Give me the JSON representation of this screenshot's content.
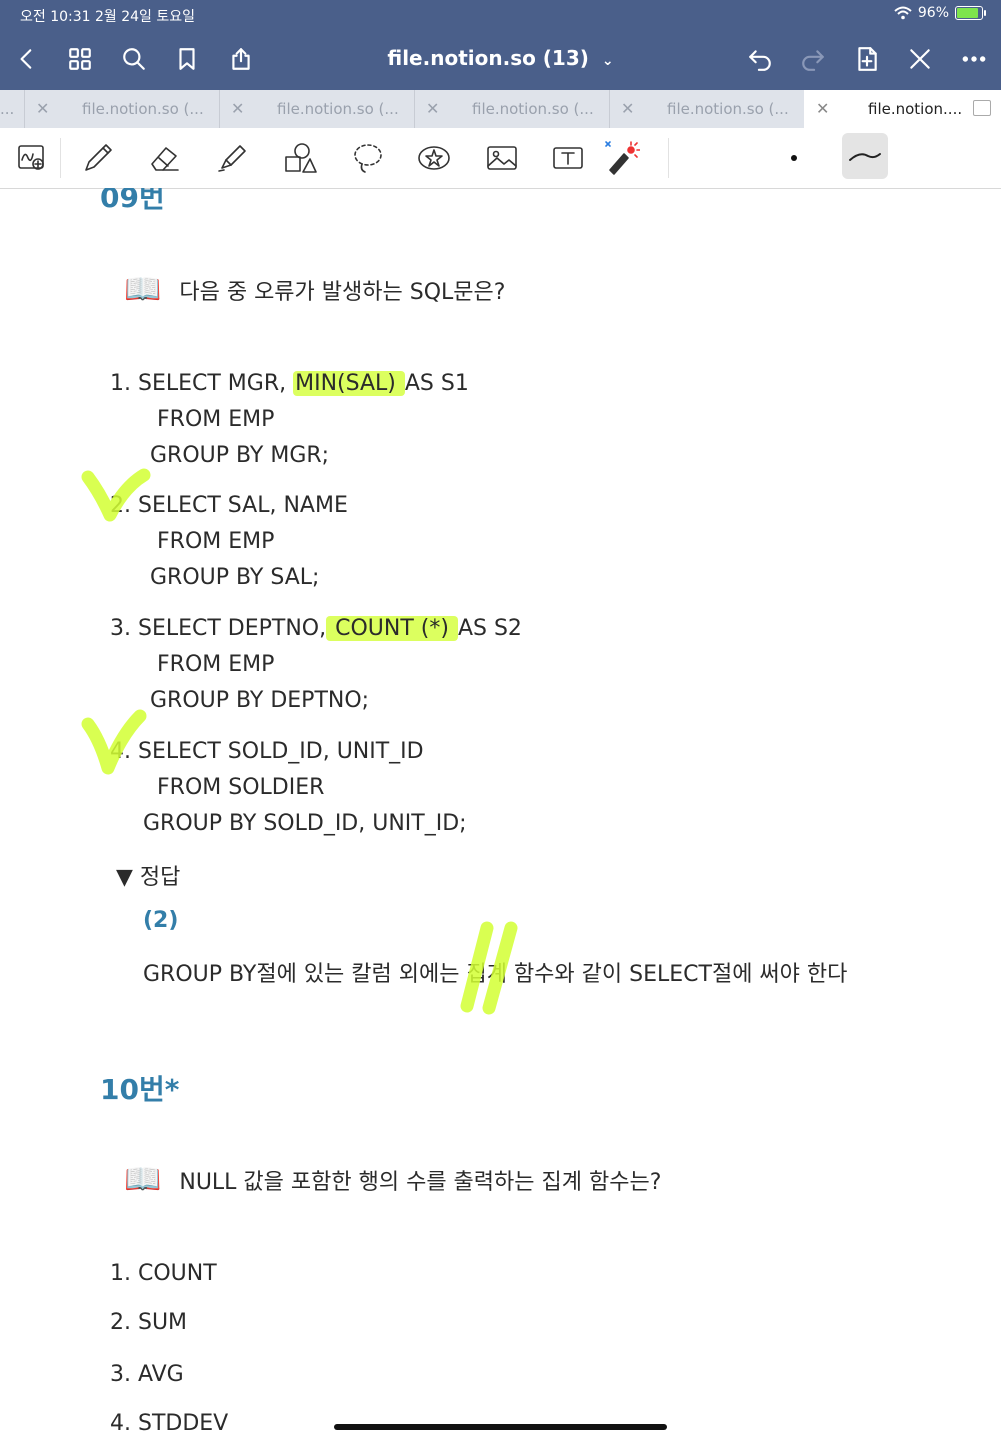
{
  "status": {
    "time": "오전 10:31   2월 24일 토요일",
    "battery": "96%",
    "battery_level": 0.96
  },
  "nav": {
    "title": "file.notion.so (13)",
    "chevron": "⌄"
  },
  "tabs": [
    {
      "label": "..."
    },
    {
      "label": "file.notion.so (..."
    },
    {
      "label": "file.notion.so (..."
    },
    {
      "label": "file.notion.so (..."
    },
    {
      "label": "file.notion.so (..."
    },
    {
      "label": "file.notion...."
    }
  ],
  "q9": {
    "heading": "09번",
    "question": "다음 중 오류가 발생하는 SQL문은?",
    "opt1": {
      "l1_a": "1.  SELECT MGR, ",
      "l1_hl": "MIN(SAL) ",
      "l1_b": "AS S1",
      "l2": "FROM EMP",
      "l3": "GROUP BY MGR;"
    },
    "opt2": {
      "l1": "2.  SELECT SAL, NAME",
      "l2": "FROM EMP",
      "l3": "GROUP BY SAL;"
    },
    "opt3": {
      "l1_a": "3.  SELECT DEPTNO,",
      "l1_hl": " COUNT (*) ",
      "l1_b": "AS S2",
      "l2": "FROM EMP",
      "l3": "GROUP BY DEPTNO;"
    },
    "opt4": {
      "l1": "4.  SELECT SOLD_ID, UNIT_ID",
      "l2": "FROM SOLDIER",
      "l3": "GROUP BY SOLD_ID, UNIT_ID;"
    },
    "toggle": "▼  정답",
    "answer": "(2)",
    "explanation": "GROUP BY절에 있는 칼럼 외에는 집계 함수와 같이 SELECT절에 써야 한다"
  },
  "q10": {
    "heading": "10번*",
    "question": "NULL 값을 포함한 행의 수를 출력하는 집계 함수는?",
    "options": [
      "1.  COUNT",
      "2.  SUM",
      "3.  AVG",
      "4.  STDDEV"
    ]
  },
  "colors": {
    "nav": "#4a5f8a",
    "heading": "#337ea9",
    "highlighter": "#d2ff32"
  }
}
